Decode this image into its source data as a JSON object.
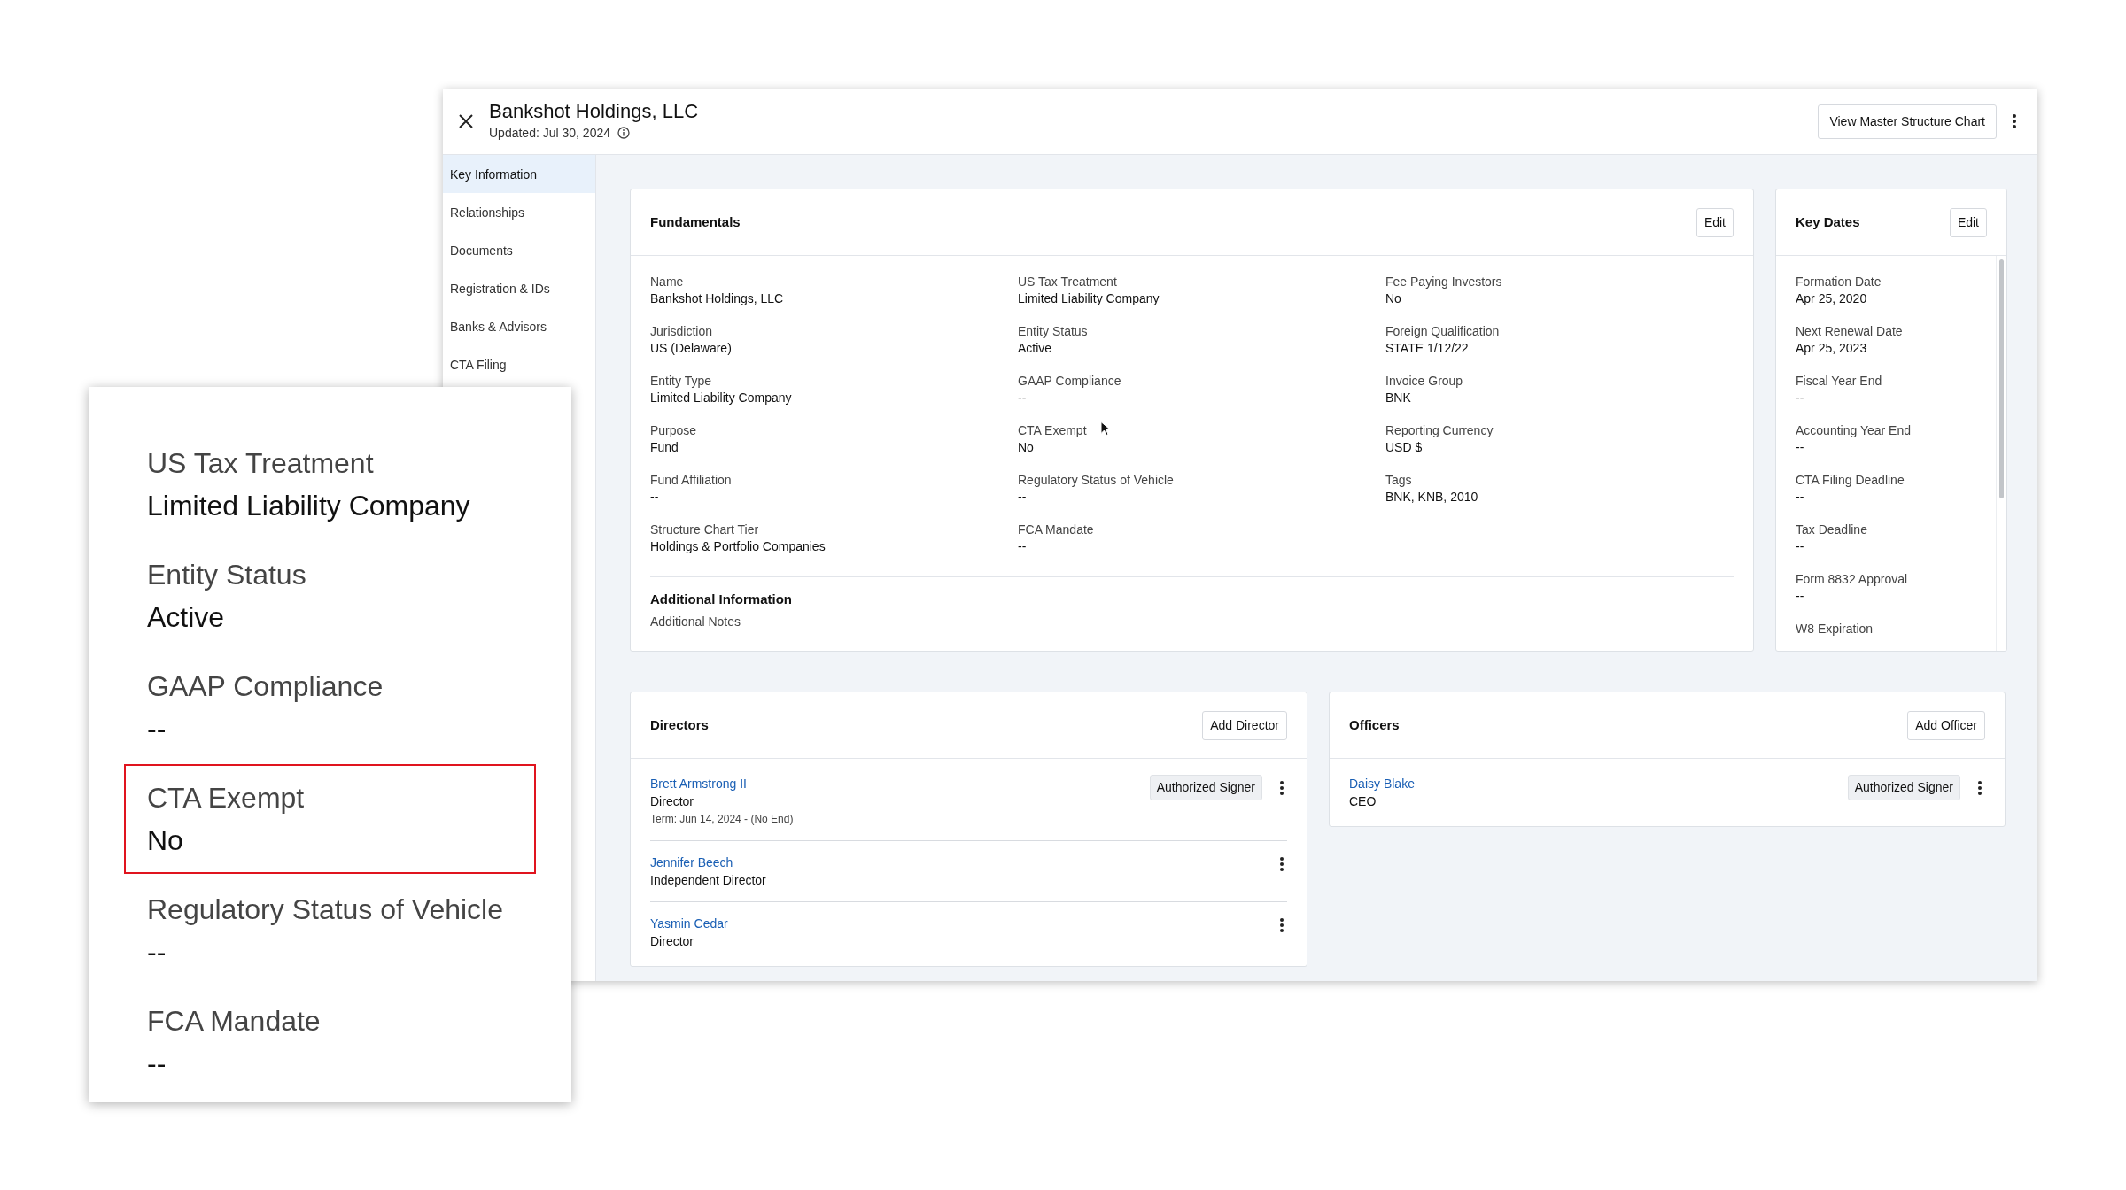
{
  "window": {
    "title": "Bankshot Holdings, LLC",
    "updated": "Updated: Jul 30, 2024",
    "header_button": "View Master Structure Chart",
    "sidebar": [
      {
        "label": "Key Information",
        "selected": true
      },
      {
        "label": "Relationships",
        "selected": false
      },
      {
        "label": "Documents",
        "selected": false
      },
      {
        "label": "Registration & IDs",
        "selected": false
      },
      {
        "label": "Banks & Advisors",
        "selected": false
      },
      {
        "label": "CTA Filing",
        "selected": false
      }
    ],
    "fundamentals": {
      "title": "Fundamentals",
      "edit_label": "Edit",
      "columns": [
        [
          {
            "label": "Name",
            "value": "Bankshot Holdings, LLC"
          },
          {
            "label": "Jurisdiction",
            "value": "US (Delaware)"
          },
          {
            "label": "Entity Type",
            "value": "Limited Liability Company"
          },
          {
            "label": "Purpose",
            "value": "Fund"
          },
          {
            "label": "Fund Affiliation",
            "value": "--"
          },
          {
            "label": "Structure Chart Tier",
            "value": "Holdings & Portfolio Companies"
          }
        ],
        [
          {
            "label": "US Tax Treatment",
            "value": "Limited Liability Company"
          },
          {
            "label": "Entity Status",
            "value": "Active"
          },
          {
            "label": "GAAP Compliance",
            "value": "--"
          },
          {
            "label": "CTA Exempt",
            "value": "No"
          },
          {
            "label": "Regulatory Status of Vehicle",
            "value": "--"
          },
          {
            "label": "FCA Mandate",
            "value": "--"
          }
        ],
        [
          {
            "label": "Fee Paying Investors",
            "value": "No"
          },
          {
            "label": "Foreign Qualification",
            "value": "STATE 1/12/22"
          },
          {
            "label": "Invoice Group",
            "value": "BNK"
          },
          {
            "label": "Reporting Currency",
            "value": "USD $"
          },
          {
            "label": "Tags",
            "value": "BNK, KNB, 2010"
          }
        ]
      ],
      "additional": {
        "title": "Additional Information",
        "text": "Additional Notes"
      }
    },
    "key_dates": {
      "title": "Key Dates",
      "edit_label": "Edit",
      "fields": [
        {
          "label": "Formation Date",
          "value": "Apr 25, 2020"
        },
        {
          "label": "Next Renewal Date",
          "value": "Apr 25, 2023"
        },
        {
          "label": "Fiscal Year End",
          "value": "--"
        },
        {
          "label": "Accounting Year End",
          "value": "--"
        },
        {
          "label": "CTA Filing Deadline",
          "value": "--"
        },
        {
          "label": "Tax Deadline",
          "value": "--"
        },
        {
          "label": "Form 8832 Approval",
          "value": "--"
        },
        {
          "label": "W8 Expiration"
        }
      ]
    },
    "directors": {
      "title": "Directors",
      "add_label": "Add Director",
      "people": [
        {
          "name": "Brett Armstrong II",
          "role": "Director",
          "term": "Term: Jun 14, 2024 - (No End)",
          "badge": "Authorized Signer"
        },
        {
          "name": "Jennifer Beech",
          "role": "Independent Director"
        },
        {
          "name": "Yasmin Cedar",
          "role": "Director"
        }
      ]
    },
    "officers": {
      "title": "Officers",
      "add_label": "Add Officer",
      "people": [
        {
          "name": "Daisy Blake",
          "role": "CEO",
          "badge": "Authorized Signer"
        }
      ]
    }
  },
  "callout": {
    "fields": [
      {
        "label": "US Tax Treatment",
        "value": "Limited Liability Company",
        "highlighted": false
      },
      {
        "label": "Entity Status",
        "value": "Active",
        "highlighted": false
      },
      {
        "label": "GAAP Compliance",
        "value": "--",
        "highlighted": false
      },
      {
        "label": "CTA Exempt",
        "value": "No",
        "highlighted": true
      },
      {
        "label": "Regulatory Status of Vehicle",
        "value": "--",
        "highlighted": false
      },
      {
        "label": "FCA Mandate",
        "value": "--",
        "highlighted": false
      }
    ]
  }
}
